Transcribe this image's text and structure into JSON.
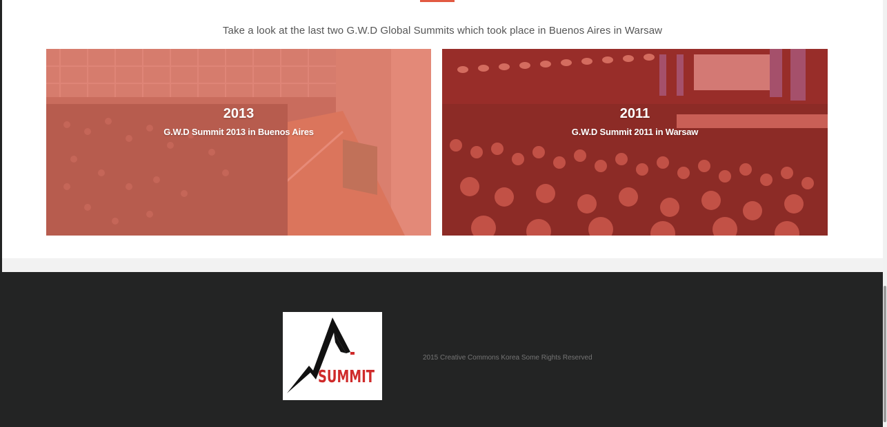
{
  "intro_text": "Take a look at the last two G.W.D Global Summits which took place in Buenos Aires in Warsaw",
  "summits": [
    {
      "year": "2013",
      "caption": "G.W.D Summit 2013 in Buenos Aires"
    },
    {
      "year": "2011",
      "caption": "G.W.D Summit 2011 in Warsaw"
    }
  ],
  "footer": {
    "logo_text": "SUMMIT",
    "copyright": "2015 Creative Commons Korea Some Rights Reserved"
  },
  "colors": {
    "accent": "#e25a42",
    "footer_bg": "#232424",
    "logo_red": "#cf2a2a"
  }
}
